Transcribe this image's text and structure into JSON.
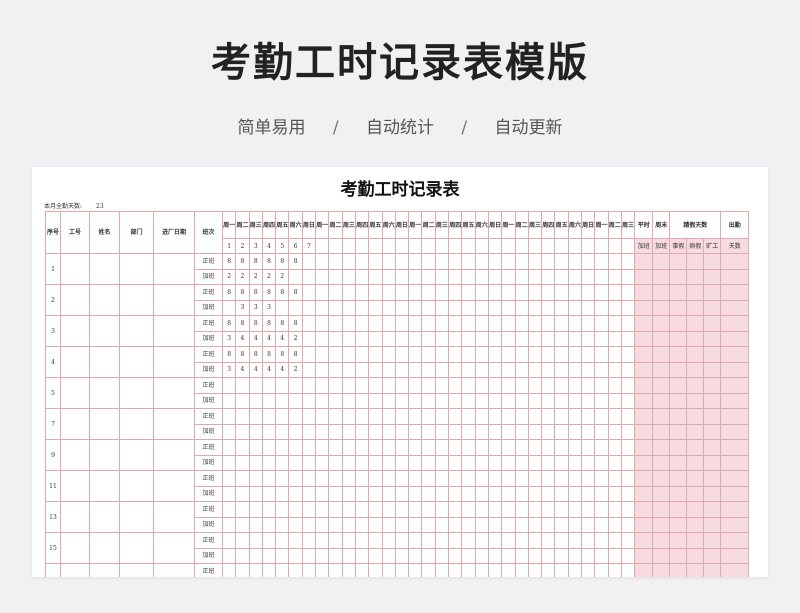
{
  "banner": {
    "title": "考勤工时记录表模版",
    "features": [
      "简单易用",
      "自动统计",
      "自动更新"
    ],
    "separator": "/"
  },
  "sheet": {
    "title": "考勤工时记录表",
    "full_days_label": "本月全勤天数:",
    "full_days_value": "23",
    "columns": {
      "seq": "序号",
      "emp_no": "工号",
      "name": "姓名",
      "dept": "部门",
      "join_date": "进厂日期",
      "shift": "班次",
      "weekday_ot": "平时",
      "weekend_ot": "周末",
      "leave_days": "請假天数",
      "attendance": "出勤"
    },
    "sub_columns": {
      "weekday_ot": "加班",
      "weekend_ot": "加班",
      "personal": "事假",
      "sick": "病假",
      "absent": "旷工",
      "attendance": "天数"
    },
    "weekdays": [
      "周一",
      "周二",
      "周三",
      "周四",
      "周五",
      "周六",
      "周日",
      "周一",
      "周二",
      "周三",
      "周四",
      "周五",
      "周六",
      "周日",
      "周一",
      "周二",
      "周三",
      "周四",
      "周五",
      "周六",
      "周日",
      "周一",
      "周二",
      "周三",
      "周四",
      "周五",
      "周六",
      "周日",
      "周一",
      "周二",
      "周三"
    ],
    "day_numbers": [
      "1",
      "2",
      "3",
      "4",
      "5",
      "6",
      "7"
    ],
    "shift_regular": "正班",
    "shift_overtime": "加班",
    "employees": [
      {
        "seq": "1",
        "regular": [
          "8",
          "8",
          "8",
          "8",
          "8",
          "8"
        ],
        "overtime": [
          "2",
          "2",
          "2",
          "2",
          "2"
        ]
      },
      {
        "seq": "2",
        "regular": [
          "8",
          "8",
          "8",
          "8",
          "8",
          "8"
        ],
        "overtime": [
          "",
          "3",
          "3",
          "3"
        ]
      },
      {
        "seq": "3",
        "regular": [
          "8",
          "8",
          "8",
          "8",
          "8",
          "8"
        ],
        "overtime": [
          "3",
          "4",
          "4",
          "4",
          "4",
          "2"
        ]
      },
      {
        "seq": "4",
        "regular": [
          "8",
          "8",
          "8",
          "8",
          "8",
          "8"
        ],
        "overtime": [
          "3",
          "4",
          "4",
          "4",
          "4",
          "2"
        ]
      },
      {
        "seq": "5",
        "regular": [],
        "overtime": []
      },
      {
        "seq": "7",
        "regular": [],
        "overtime": []
      },
      {
        "seq": "9",
        "regular": [],
        "overtime": []
      },
      {
        "seq": "11",
        "regular": [],
        "overtime": []
      },
      {
        "seq": "13",
        "regular": [],
        "overtime": []
      },
      {
        "seq": "15",
        "regular": [],
        "overtime": []
      },
      {
        "seq": "",
        "regular": [],
        "overtime": []
      }
    ]
  }
}
